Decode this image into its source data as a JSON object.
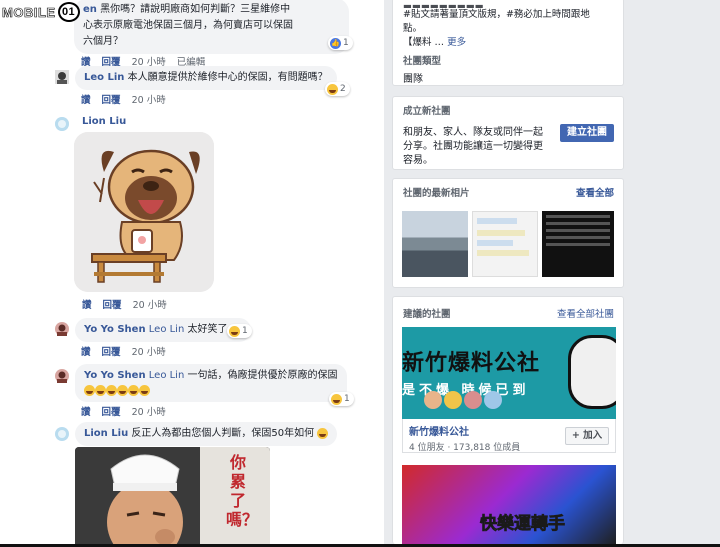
{
  "logo": {
    "text": "MOBILE",
    "oval": "01"
  },
  "comments": [
    {
      "name": "Yo Yo Shen",
      "name_visible": "en",
      "text": "黑你嗎？請說明廠商如何判斷？三星維修中心表示原廠電池保固三個月，為何賣店可以保固六個月？",
      "line1": "黑你嗎？請說明廠商如何判斷？三星維修中",
      "line2": "心表示原廠電池保固三個月，為何賣店可以保固",
      "line3": "六個月？",
      "actions": [
        "讚",
        "回覆",
        "20 小時",
        "已編輯"
      ],
      "reaction_count": "1"
    },
    {
      "name": "Leo Lin",
      "text": "本人願意提供於維修中心的保固，有問題嗎？",
      "actions": [
        "讚",
        "回覆",
        "20 小時"
      ],
      "reaction_count": "2"
    },
    {
      "name": "Lion Liu",
      "text": "",
      "actions": [
        "讚",
        "回覆",
        "20 小時"
      ]
    },
    {
      "name": "Yo Yo Shen",
      "mention": "Leo Lin",
      "text": "太好笑了",
      "actions": [
        "讚",
        "回覆",
        "20 小時"
      ],
      "reaction_count": "1"
    },
    {
      "name": "Yo Yo Shen",
      "mention": "Leo Lin",
      "text": "一句話，偽廠提供優於原廠的保固",
      "actions": [
        "讚",
        "回覆",
        "20 小時"
      ],
      "reaction_count": "1"
    },
    {
      "name": "Lion Liu",
      "text": "反正人為都由您個人判斷，保固50年如何",
      "actions": [
        "讚",
        "回覆",
        "20 小時"
      ]
    }
  ],
  "meme_text": "你累了嗎？",
  "group_info": {
    "line1": "#貼文請著量頂文版規，#務必加上時間跟地",
    "line2": "點。",
    "line3": "【爆料",
    "more": "更多",
    "type_label": "社團類型",
    "type_value": "團隊"
  },
  "create_group": {
    "title": "成立新社團",
    "desc_line1": "和朋友、家人、隊友或同伴一起",
    "desc_line2": "分享。社團功能讓這一切變得更",
    "desc_line3": "容易。",
    "button": "建立社團"
  },
  "photos": {
    "title": "社團的最新相片",
    "see_all": "查看全部"
  },
  "suggested": {
    "title": "建議的社團",
    "see_all": "查看全部社團",
    "banner_title": "新竹爆料公社",
    "banner_sub": "是不爆 時候已到",
    "group_name": "新竹爆料公社",
    "meta": "4 位朋友 · 173,818 位成員",
    "join": "+ 加入",
    "banner2_text": "快樂運轉手"
  },
  "colors": {
    "brand_blue": "#4267b2",
    "link": "#385898",
    "banner_teal": "#1d9aa5"
  }
}
